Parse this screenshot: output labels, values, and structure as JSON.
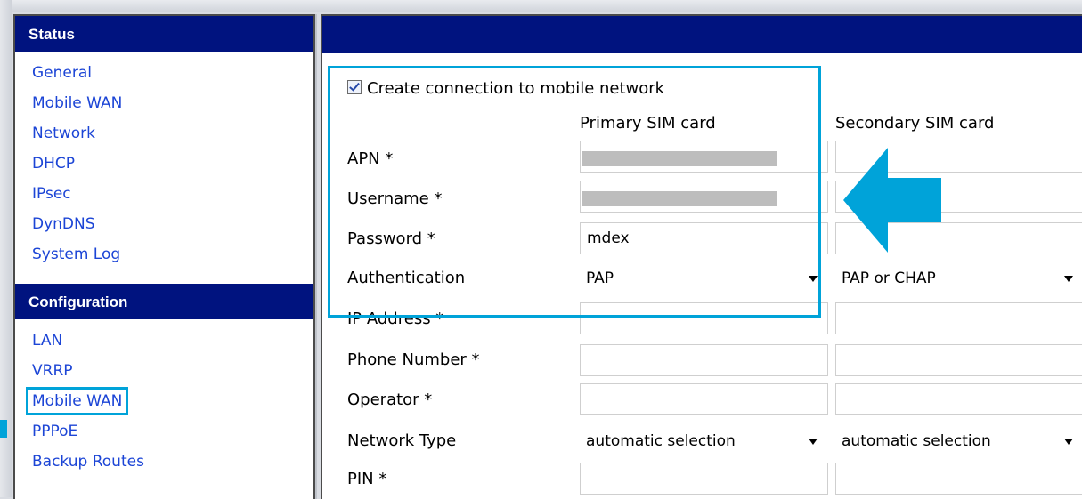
{
  "sidebar": {
    "status_header": "Status",
    "status_items": [
      "General",
      "Mobile WAN",
      "Network",
      "DHCP",
      "IPsec",
      "DynDNS",
      "System Log"
    ],
    "config_header": "Configuration",
    "config_items": [
      "LAN",
      "VRRP",
      "Mobile WAN",
      "PPPoE",
      "Backup Routes"
    ],
    "selected": "Mobile WAN"
  },
  "main": {
    "create_connection_label": "Create connection to mobile network",
    "create_connection_checked": true,
    "col_primary": "Primary SIM card",
    "col_secondary": "Secondary SIM card",
    "rows": {
      "apn": {
        "label": "APN *",
        "primary": "",
        "secondary": ""
      },
      "username": {
        "label": "Username *",
        "primary": "",
        "secondary": ""
      },
      "password": {
        "label": "Password *",
        "primary": "mdex",
        "secondary": ""
      },
      "authentication": {
        "label": "Authentication",
        "primary": "PAP",
        "secondary": "PAP or CHAP"
      },
      "ip_address": {
        "label": "IP Address *",
        "primary": "",
        "secondary": ""
      },
      "phone_number": {
        "label": "Phone Number *",
        "primary": "",
        "secondary": ""
      },
      "operator": {
        "label": "Operator *",
        "primary": "",
        "secondary": ""
      },
      "network_type": {
        "label": "Network Type",
        "primary": "automatic selection",
        "secondary": "automatic selection"
      },
      "pin": {
        "label": "PIN *",
        "primary": "",
        "secondary": ""
      }
    }
  },
  "colors": {
    "header_bg": "#00137f",
    "link": "#1c45d6",
    "highlight": "#00a3d9"
  },
  "icons": {
    "checkbox": "checkbox-checked-icon",
    "dropdown": "chevron-down-icon",
    "annotation": "arrow-left-icon"
  }
}
